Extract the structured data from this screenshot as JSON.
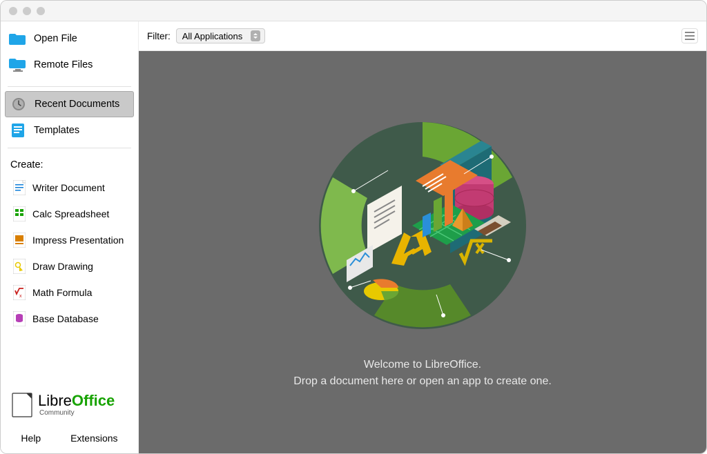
{
  "sidebar": {
    "openFile": "Open File",
    "remoteFiles": "Remote Files",
    "recentDocuments": "Recent Documents",
    "templates": "Templates",
    "createLabel": "Create:",
    "create": {
      "writer": "Writer Document",
      "calc": "Calc Spreadsheet",
      "impress": "Impress Presentation",
      "draw": "Draw Drawing",
      "math": "Math Formula",
      "base": "Base Database"
    },
    "logoText": "Libre",
    "logoOffice": "Office",
    "logoCommunity": "Community",
    "help": "Help",
    "extensions": "Extensions"
  },
  "topbar": {
    "filterLabel": "Filter:",
    "filterSelected": "All Applications"
  },
  "welcome": {
    "line1": "Welcome to LibreOffice.",
    "line2": "Drop a document here or open an app to create one."
  },
  "colors": {
    "accent": "#18a303",
    "sidebarSelected": "#c9c9c9",
    "contentBg": "#6b6b6b"
  }
}
